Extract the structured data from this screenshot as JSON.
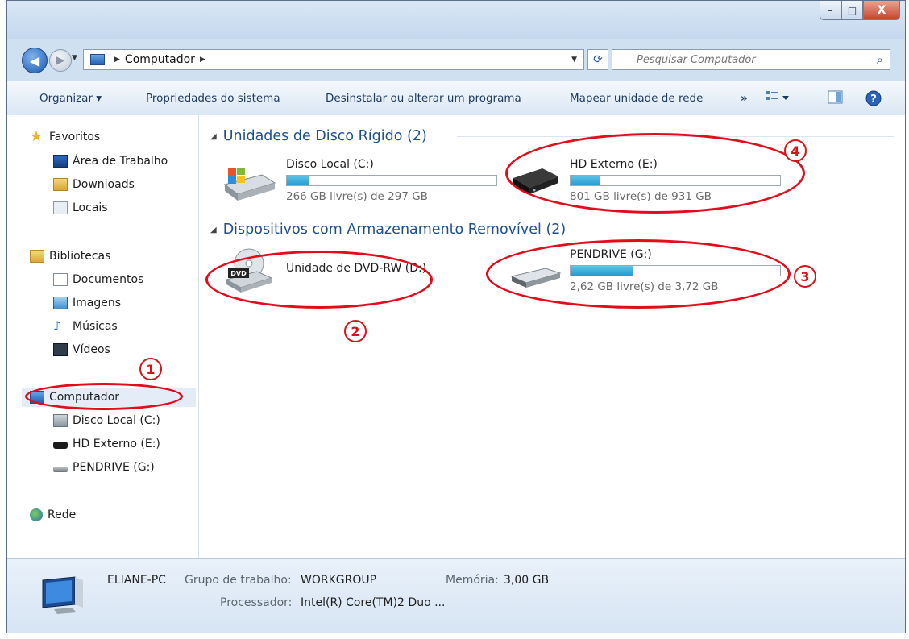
{
  "window": {
    "buttons": {
      "minimize": "–",
      "maximize": "□",
      "close": "X"
    }
  },
  "address": {
    "location": "Computador",
    "search_placeholder": "Pesquisar Computador"
  },
  "toolbar": {
    "organize": "Organizar ▾",
    "system_properties": "Propriedades do sistema",
    "uninstall": "Desinstalar ou alterar um programa",
    "map_drive": "Mapear unidade de rede",
    "more": "»"
  },
  "sidebar": {
    "favorites": {
      "label": "Favoritos",
      "items": [
        "Área de Trabalho",
        "Downloads",
        "Locais"
      ]
    },
    "libraries": {
      "label": "Bibliotecas",
      "items": [
        "Documentos",
        "Imagens",
        "Músicas",
        "Vídeos"
      ]
    },
    "computer": {
      "label": "Computador",
      "items": [
        "Disco Local (C:)",
        "HD Externo (E:)",
        "PENDRIVE (G:)"
      ]
    },
    "network": {
      "label": "Rede"
    }
  },
  "groups": {
    "hard_disks": {
      "title": "Unidades de Disco Rígido (2)",
      "drives": [
        {
          "name": "Disco Local (C:)",
          "free": "266 GB livre(s) de 297 GB",
          "used_fraction": 0.104,
          "icon": "windows-drive-icon"
        },
        {
          "name": "HD Externo (E:)",
          "free": "801 GB livre(s) de 931 GB",
          "used_fraction": 0.14,
          "icon": "external-hdd-icon"
        }
      ]
    },
    "removable": {
      "title": "Dispositivos com Armazenamento Removível (2)",
      "drives": [
        {
          "name": "Unidade de DVD-RW (D:)",
          "icon": "dvd-drive-icon"
        },
        {
          "name": "PENDRIVE (G:)",
          "free": "2,62 GB livre(s) de 3,72 GB",
          "used_fraction": 0.296,
          "icon": "usb-drive-icon"
        }
      ]
    }
  },
  "callouts": [
    "1",
    "2",
    "3",
    "4"
  ],
  "details": {
    "computer_name": "ELIANE-PC",
    "workgroup_label": "Grupo de trabalho:",
    "workgroup_value": "WORKGROUP",
    "memory_label": "Memória:",
    "memory_value": "3,00 GB",
    "processor_label": "Processador:",
    "processor_value": "Intel(R) Core(TM)2 Duo ..."
  },
  "colors": {
    "accent": "#1e4f93",
    "annotation": "#e20d1c",
    "bar_fill": "#259bcf"
  }
}
